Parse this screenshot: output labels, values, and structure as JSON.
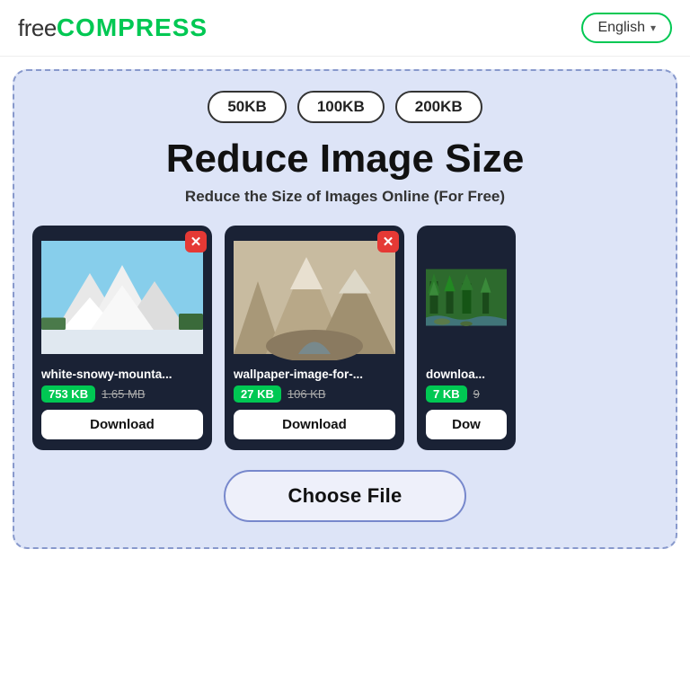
{
  "header": {
    "logo_free": "free",
    "logo_compress": "COMPRESS",
    "lang_button": "English",
    "lang_chevron": "▾"
  },
  "main": {
    "size_presets": [
      "50KB",
      "100KB",
      "200KB"
    ],
    "title": "Reduce Image Size",
    "subtitle": "Reduce the Size of Images Online (For Free)",
    "cards": [
      {
        "id": 1,
        "filename": "white-snowy-mounta...",
        "size_new": "753 KB",
        "size_old": "1.65 MB",
        "download_label": "Download",
        "image_type": "snow",
        "partial": false
      },
      {
        "id": 2,
        "filename": "wallpaper-image-for-...",
        "size_new": "27 KB",
        "size_old": "106 KB",
        "download_label": "Download",
        "image_type": "mountain",
        "partial": false
      },
      {
        "id": 3,
        "filename": "downloa...",
        "size_new": "7 KB",
        "size_old": "9",
        "download_label": "Dow",
        "image_type": "forest",
        "partial": true
      }
    ],
    "choose_file_label": "Choose File"
  }
}
